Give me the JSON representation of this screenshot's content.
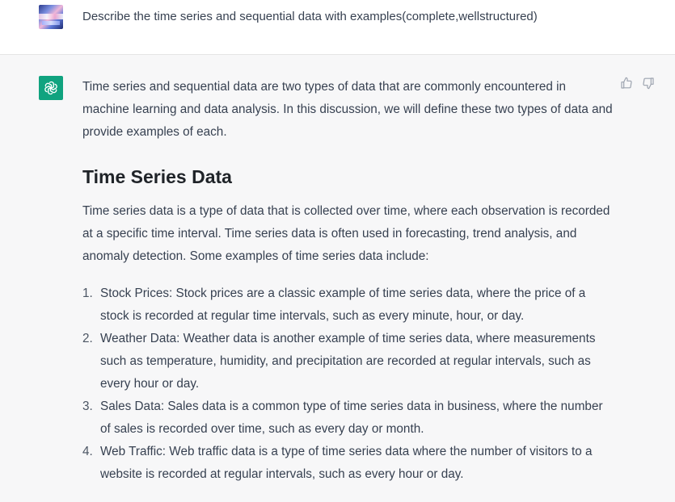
{
  "user_message": {
    "text": "Describe the time series and sequential data with examples(complete,wellstructured)"
  },
  "assistant_message": {
    "intro": "Time series and sequential data are two types of data that are commonly encountered in machine learning and data analysis. In this discussion, we will define these two types of data and provide examples of each.",
    "section_heading": "Time Series Data",
    "section_paragraph": "Time series data is a type of data that is collected over time, where each observation is recorded at a specific time interval. Time series data is often used in forecasting, trend analysis, and anomaly detection. Some examples of time series data include:",
    "examples": [
      {
        "number": "1.",
        "text": "Stock Prices: Stock prices are a classic example of time series data, where the price of a stock is recorded at regular time intervals, such as every minute, hour, or day."
      },
      {
        "number": "2.",
        "text": "Weather Data: Weather data is another example of time series data, where measurements such as temperature, humidity, and precipitation are recorded at regular intervals, such as every hour or day."
      },
      {
        "number": "3.",
        "text": "Sales Data: Sales data is a common type of time series data in business, where the number of sales is recorded over time, such as every day or month."
      },
      {
        "number": "4.",
        "text": "Web Traffic: Web traffic data is a type of time series data where the number of visitors to a website is recorded at regular intervals, such as every hour or day."
      }
    ]
  },
  "icons": {
    "assistant_avatar": "openai-logo-icon",
    "thumbs_up": "thumbs-up-icon",
    "thumbs_down": "thumbs-down-icon"
  },
  "colors": {
    "assistant_avatar_bg": "#10a37f",
    "assistant_row_bg": "#f7f7f8",
    "text": "#374151"
  }
}
